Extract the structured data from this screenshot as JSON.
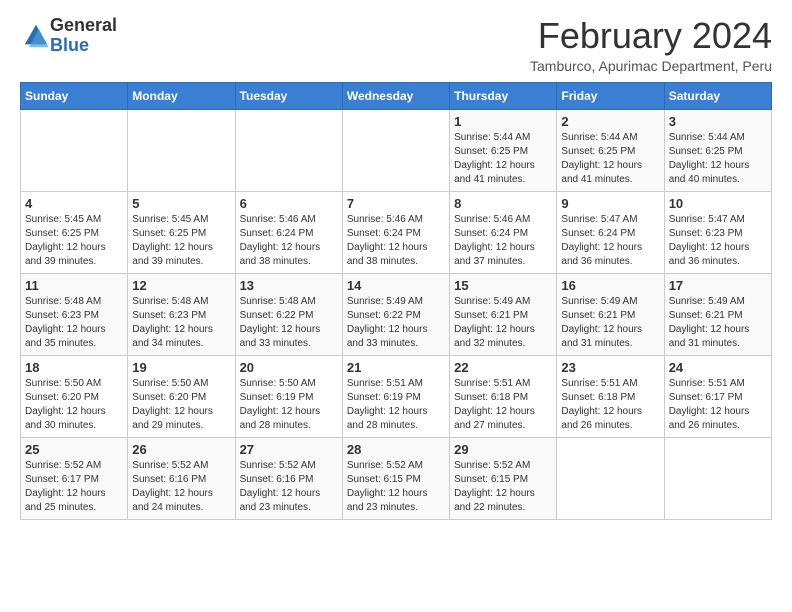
{
  "logo": {
    "general": "General",
    "blue": "Blue"
  },
  "title": "February 2024",
  "location": "Tamburco, Apurimac Department, Peru",
  "days_header": [
    "Sunday",
    "Monday",
    "Tuesday",
    "Wednesday",
    "Thursday",
    "Friday",
    "Saturday"
  ],
  "weeks": [
    [
      {
        "day": "",
        "info": ""
      },
      {
        "day": "",
        "info": ""
      },
      {
        "day": "",
        "info": ""
      },
      {
        "day": "",
        "info": ""
      },
      {
        "day": "1",
        "info": "Sunrise: 5:44 AM\nSunset: 6:25 PM\nDaylight: 12 hours\nand 41 minutes."
      },
      {
        "day": "2",
        "info": "Sunrise: 5:44 AM\nSunset: 6:25 PM\nDaylight: 12 hours\nand 41 minutes."
      },
      {
        "day": "3",
        "info": "Sunrise: 5:44 AM\nSunset: 6:25 PM\nDaylight: 12 hours\nand 40 minutes."
      }
    ],
    [
      {
        "day": "4",
        "info": "Sunrise: 5:45 AM\nSunset: 6:25 PM\nDaylight: 12 hours\nand 39 minutes."
      },
      {
        "day": "5",
        "info": "Sunrise: 5:45 AM\nSunset: 6:25 PM\nDaylight: 12 hours\nand 39 minutes."
      },
      {
        "day": "6",
        "info": "Sunrise: 5:46 AM\nSunset: 6:24 PM\nDaylight: 12 hours\nand 38 minutes."
      },
      {
        "day": "7",
        "info": "Sunrise: 5:46 AM\nSunset: 6:24 PM\nDaylight: 12 hours\nand 38 minutes."
      },
      {
        "day": "8",
        "info": "Sunrise: 5:46 AM\nSunset: 6:24 PM\nDaylight: 12 hours\nand 37 minutes."
      },
      {
        "day": "9",
        "info": "Sunrise: 5:47 AM\nSunset: 6:24 PM\nDaylight: 12 hours\nand 36 minutes."
      },
      {
        "day": "10",
        "info": "Sunrise: 5:47 AM\nSunset: 6:23 PM\nDaylight: 12 hours\nand 36 minutes."
      }
    ],
    [
      {
        "day": "11",
        "info": "Sunrise: 5:48 AM\nSunset: 6:23 PM\nDaylight: 12 hours\nand 35 minutes."
      },
      {
        "day": "12",
        "info": "Sunrise: 5:48 AM\nSunset: 6:23 PM\nDaylight: 12 hours\nand 34 minutes."
      },
      {
        "day": "13",
        "info": "Sunrise: 5:48 AM\nSunset: 6:22 PM\nDaylight: 12 hours\nand 33 minutes."
      },
      {
        "day": "14",
        "info": "Sunrise: 5:49 AM\nSunset: 6:22 PM\nDaylight: 12 hours\nand 33 minutes."
      },
      {
        "day": "15",
        "info": "Sunrise: 5:49 AM\nSunset: 6:21 PM\nDaylight: 12 hours\nand 32 minutes."
      },
      {
        "day": "16",
        "info": "Sunrise: 5:49 AM\nSunset: 6:21 PM\nDaylight: 12 hours\nand 31 minutes."
      },
      {
        "day": "17",
        "info": "Sunrise: 5:49 AM\nSunset: 6:21 PM\nDaylight: 12 hours\nand 31 minutes."
      }
    ],
    [
      {
        "day": "18",
        "info": "Sunrise: 5:50 AM\nSunset: 6:20 PM\nDaylight: 12 hours\nand 30 minutes."
      },
      {
        "day": "19",
        "info": "Sunrise: 5:50 AM\nSunset: 6:20 PM\nDaylight: 12 hours\nand 29 minutes."
      },
      {
        "day": "20",
        "info": "Sunrise: 5:50 AM\nSunset: 6:19 PM\nDaylight: 12 hours\nand 28 minutes."
      },
      {
        "day": "21",
        "info": "Sunrise: 5:51 AM\nSunset: 6:19 PM\nDaylight: 12 hours\nand 28 minutes."
      },
      {
        "day": "22",
        "info": "Sunrise: 5:51 AM\nSunset: 6:18 PM\nDaylight: 12 hours\nand 27 minutes."
      },
      {
        "day": "23",
        "info": "Sunrise: 5:51 AM\nSunset: 6:18 PM\nDaylight: 12 hours\nand 26 minutes."
      },
      {
        "day": "24",
        "info": "Sunrise: 5:51 AM\nSunset: 6:17 PM\nDaylight: 12 hours\nand 26 minutes."
      }
    ],
    [
      {
        "day": "25",
        "info": "Sunrise: 5:52 AM\nSunset: 6:17 PM\nDaylight: 12 hours\nand 25 minutes."
      },
      {
        "day": "26",
        "info": "Sunrise: 5:52 AM\nSunset: 6:16 PM\nDaylight: 12 hours\nand 24 minutes."
      },
      {
        "day": "27",
        "info": "Sunrise: 5:52 AM\nSunset: 6:16 PM\nDaylight: 12 hours\nand 23 minutes."
      },
      {
        "day": "28",
        "info": "Sunrise: 5:52 AM\nSunset: 6:15 PM\nDaylight: 12 hours\nand 23 minutes."
      },
      {
        "day": "29",
        "info": "Sunrise: 5:52 AM\nSunset: 6:15 PM\nDaylight: 12 hours\nand 22 minutes."
      },
      {
        "day": "",
        "info": ""
      },
      {
        "day": "",
        "info": ""
      }
    ]
  ]
}
